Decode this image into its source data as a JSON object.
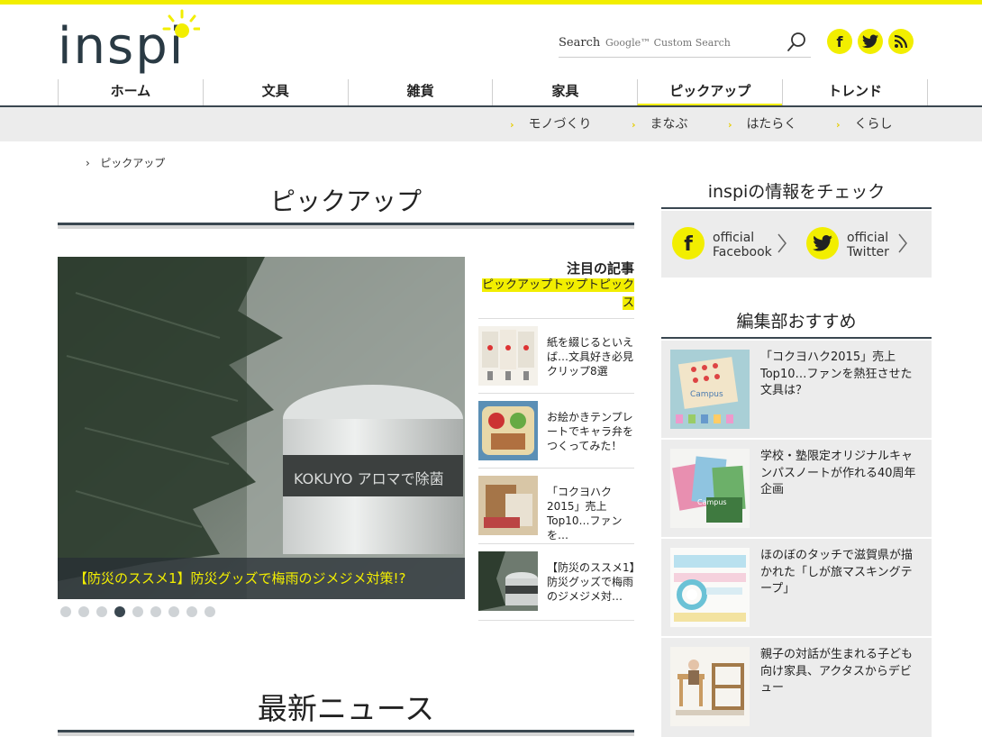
{
  "brand": {
    "logo_text": "inspi"
  },
  "search": {
    "label": "Search",
    "placeholder": "Google™ Custom Search"
  },
  "social": {
    "facebook": "f",
    "twitter": "twitter",
    "rss": "rss"
  },
  "nav": {
    "items": [
      "ホーム",
      "文具",
      "雑貨",
      "家具",
      "ピックアップ",
      "トレンド"
    ],
    "active": "ピックアップ"
  },
  "subnav": {
    "items": [
      "モノづくり",
      "まなぶ",
      "はたらく",
      "くらし"
    ]
  },
  "breadcrumb": {
    "sep": "›",
    "current": "ピックアップ"
  },
  "main": {
    "title": "ピックアップ",
    "slider": {
      "caption": "【防災のススメ1】防災グッズで梅雨のジメジメ対策!?",
      "image_text": "KOKUYO アロマで除菌",
      "dot_count": 9,
      "active_dot": 4
    },
    "featured": {
      "heading": "注目の記事",
      "tag": "ピックアップトップトピックス",
      "items": [
        {
          "text": "紙を綴じるといえば…文具好き必見クリップ8選",
          "thumb": "campus-notebooks"
        },
        {
          "text": "お絵かきテンプレートでキャラ弁をつくってみた！",
          "thumb": "bento"
        },
        {
          "text": "「コクヨハク2015」売上Top10…ファンを…",
          "thumb": "kokuyo-haku"
        },
        {
          "text": "【防災のススメ1】防災グッズで梅雨のジメジメ対…",
          "thumb": "aroma-container"
        }
      ]
    },
    "news_title": "最新ニュース"
  },
  "sidebar": {
    "check_title": "inspiの情報をチェック",
    "facebook": {
      "line1": "official",
      "line2": "Facebook"
    },
    "twitter": {
      "line1": "official",
      "line2": "Twitter"
    },
    "recommend_title": "編集部おすすめ",
    "recommend": [
      {
        "text": "「コクヨハク2015」売上Top10…ファンを熱狂させた文具は？",
        "thumb": "campus-cards"
      },
      {
        "text": "学校・塾限定オリジナルキャンパスノートが作れる40周年企画",
        "thumb": "campus-notes"
      },
      {
        "text": "ほのぼのタッチで滋賀県が描かれた「しが旅マスキングテープ」",
        "thumb": "masking-tape"
      },
      {
        "text": "親子の対話が生まれる子ども向け家具、アクタスからデビュー",
        "thumb": "kids-furniture"
      }
    ]
  },
  "colors": {
    "accent": "#f2ee00",
    "navy": "#3a4750",
    "panel": "#ececec"
  }
}
